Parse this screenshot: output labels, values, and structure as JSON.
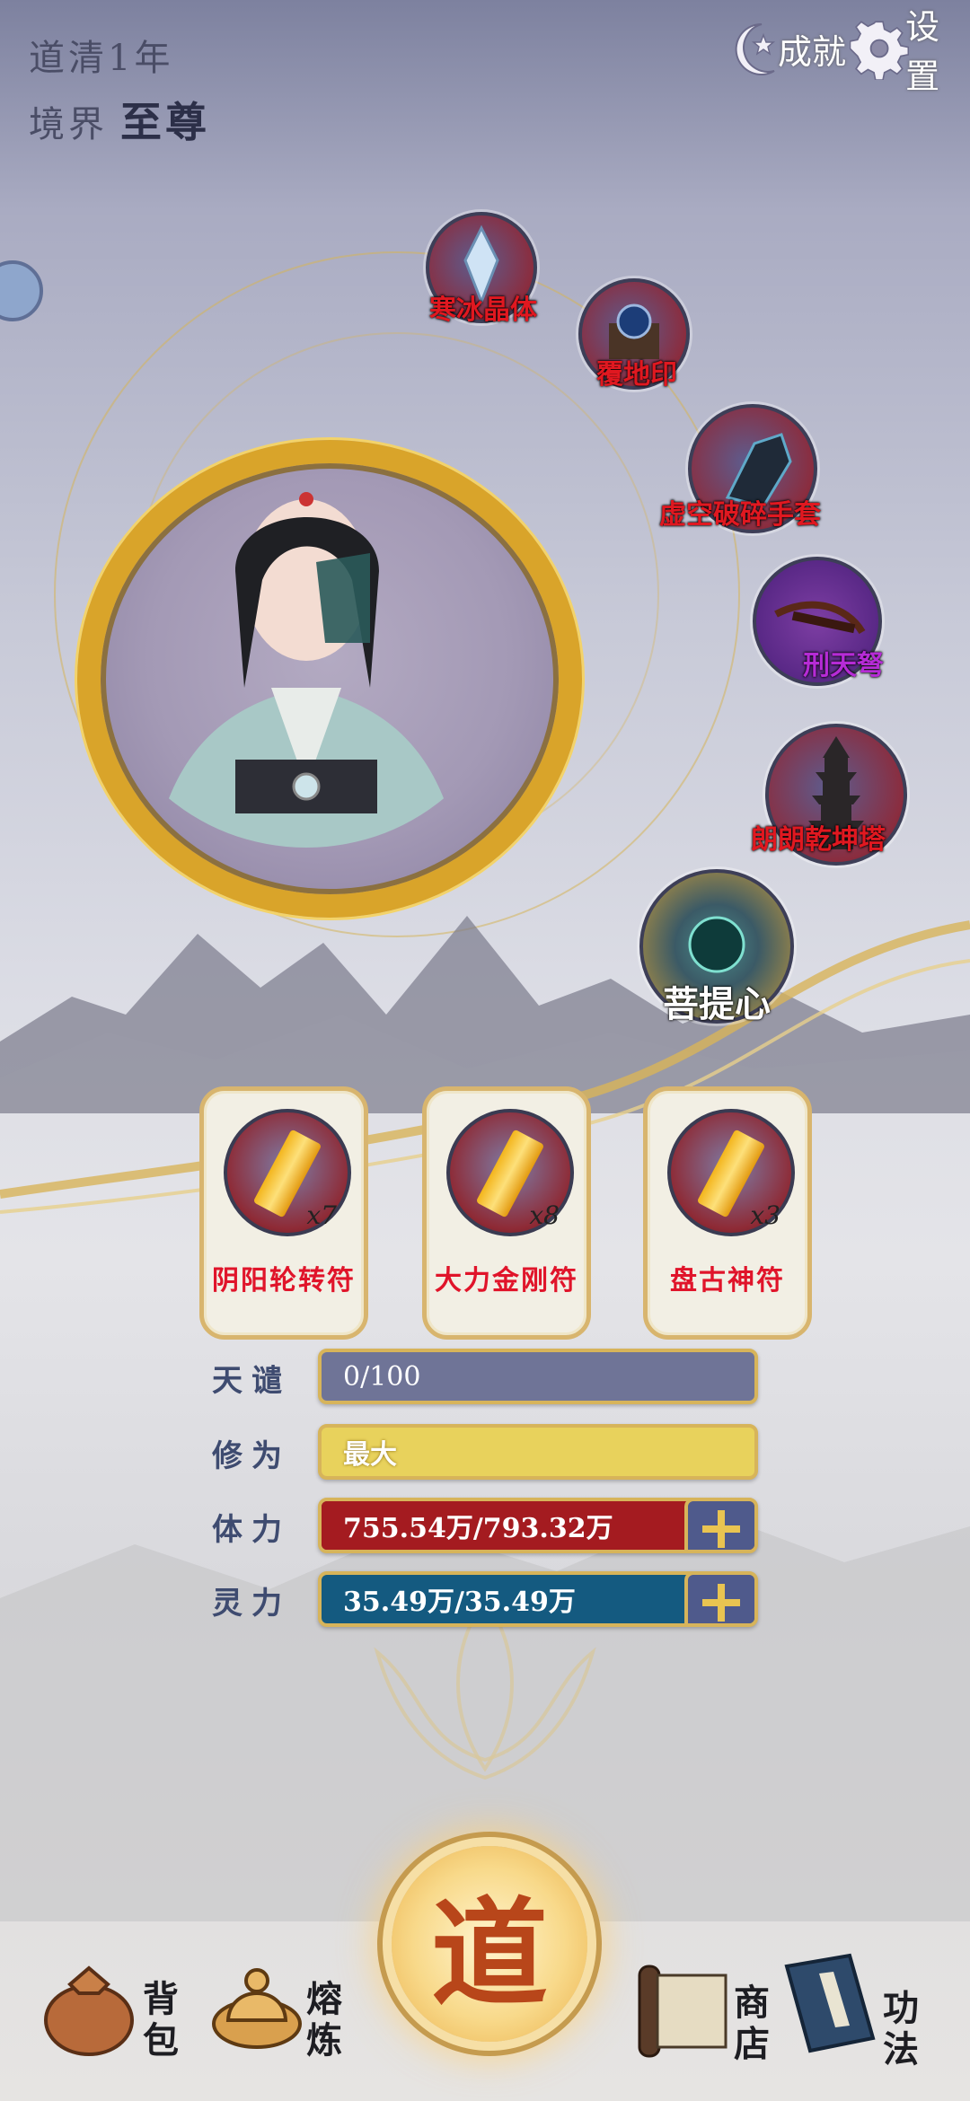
{
  "header": {
    "dao_label": "道清",
    "dao_year": "1年",
    "realm_label": "境界",
    "realm_value": "至尊",
    "achievement_label": "成就",
    "settings_label": "设置"
  },
  "artifacts": [
    {
      "label": "寒冰晶体"
    },
    {
      "label": "覆地印"
    },
    {
      "label": "虚空破碎手套"
    },
    {
      "label": "刑天弩"
    },
    {
      "label": "朗朗乾坤塔"
    },
    {
      "label": "菩提心"
    }
  ],
  "talismans": [
    {
      "label": "阴阳轮转符",
      "count": "x7"
    },
    {
      "label": "大力金刚符",
      "count": "x8"
    },
    {
      "label": "盘古神符",
      "count": "x3"
    }
  ],
  "stats": [
    {
      "label": "天谴",
      "value": "0/100",
      "fill": 0
    },
    {
      "label": "修为",
      "value": "最大",
      "fill": 1
    },
    {
      "label": "体力",
      "value": "755.54万/793.32万",
      "fill": 0.952
    },
    {
      "label": "灵力",
      "value": "35.49万/35.49万",
      "fill": 1
    }
  ],
  "colors": {
    "accent_gold": "#d9a42a",
    "tianqian": "#6f7497",
    "xiuwei": "#e8d25c",
    "tili": "#a41b20",
    "lingli": "#145a80"
  },
  "center_button": {
    "glyph": "道"
  },
  "nav": [
    {
      "label": "背包",
      "icon": "bag-icon"
    },
    {
      "label": "熔炼",
      "icon": "smelt-icon"
    },
    {
      "label": "商店",
      "icon": "scroll-shop-icon"
    },
    {
      "label": "功法",
      "icon": "book-icon"
    }
  ]
}
